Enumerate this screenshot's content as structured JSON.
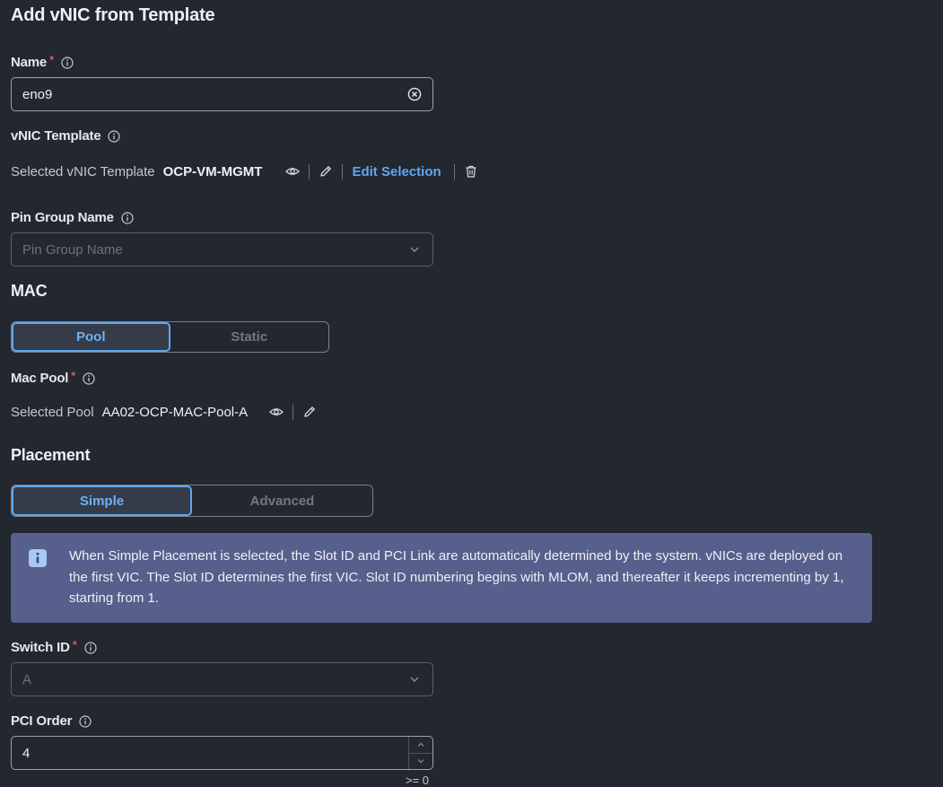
{
  "title": "Add vNIC from Template",
  "name": {
    "label": "Name",
    "required": "*",
    "value": "eno9"
  },
  "vnic_template": {
    "label": "vNIC Template",
    "selected_label": "Selected vNIC Template",
    "selected_value": "OCP-VM-MGMT",
    "edit_selection": "Edit Selection"
  },
  "pin_group": {
    "label": "Pin Group Name",
    "placeholder": "Pin Group Name"
  },
  "mac": {
    "section": "MAC",
    "options": [
      "Pool",
      "Static"
    ],
    "selected": "Pool",
    "mac_pool": {
      "label": "Mac Pool",
      "required": "*",
      "selected_label": "Selected Pool",
      "selected_value": "AA02-OCP-MAC-Pool-A"
    }
  },
  "placement": {
    "section": "Placement",
    "options": [
      "Simple",
      "Advanced"
    ],
    "selected": "Simple",
    "info_text": "When Simple Placement is selected, the Slot ID and PCI Link are automatically determined by the system. vNICs are deployed on the first VIC. The Slot ID determines the first VIC. Slot ID numbering begins with MLOM, and thereafter it keeps incrementing by 1, starting from 1."
  },
  "switch_id": {
    "label": "Switch ID",
    "required": "*",
    "value": "A"
  },
  "pci_order": {
    "label": "PCI Order",
    "value": "4",
    "hint": ">= 0"
  },
  "colors": {
    "accent": "#5fa8f2",
    "required": "#e0565b",
    "banner": "#575f8c",
    "background": "#23272f"
  }
}
